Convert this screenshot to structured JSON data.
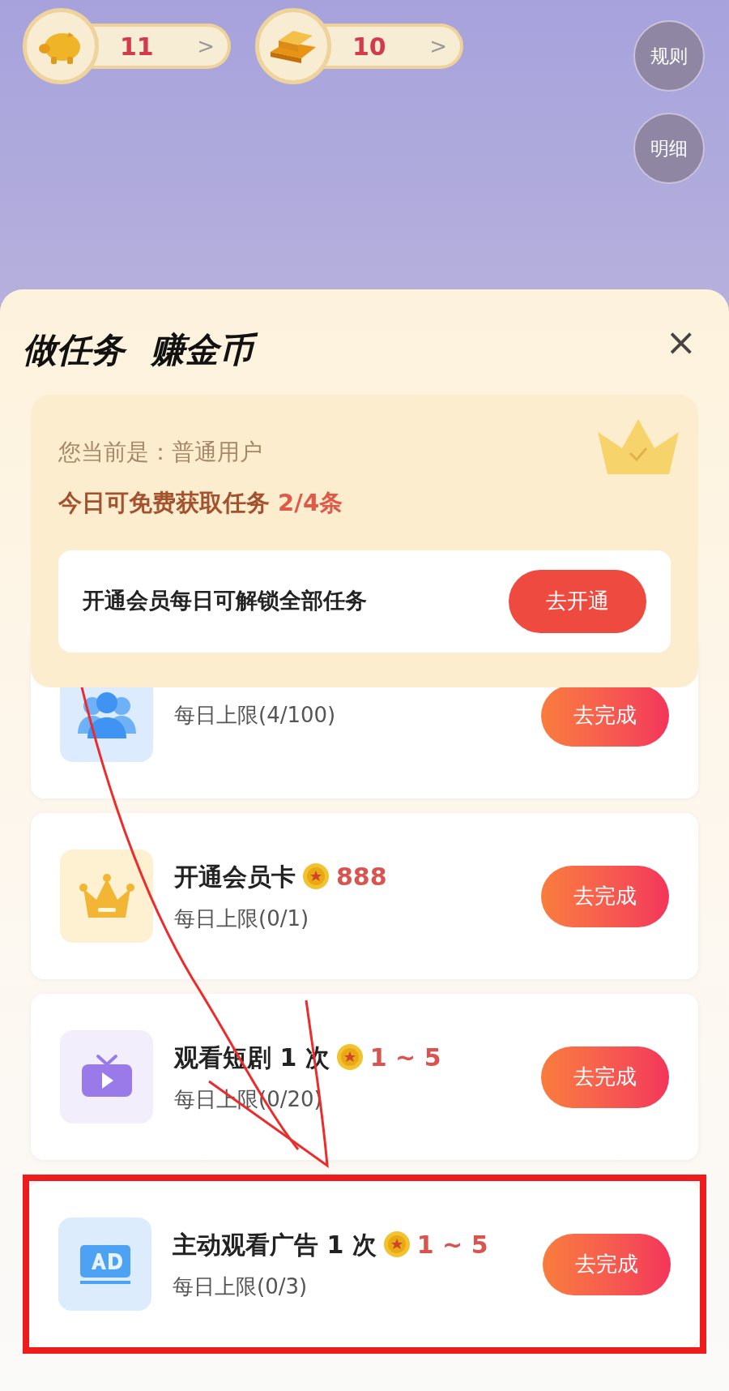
{
  "balances": [
    {
      "kind": "piggy",
      "value": "11",
      "arrow": ">"
    },
    {
      "kind": "gold",
      "value": "10",
      "arrow": ">"
    }
  ],
  "side_buttons": [
    "规则",
    "明细"
  ],
  "sheet": {
    "title_parts": [
      "做任务",
      "赚金币"
    ],
    "close": "×",
    "member": {
      "status": "您当前是：普通用户",
      "quota": "今日可免费获取任务 **2/4条**",
      "promo": "开通会员每日可解锁全部任务",
      "button": "去开通"
    },
    "tasks": [
      {
        "kind": "people",
        "limit": "每日上限(4/100)",
        "button": "去完成",
        "highlighted": false
      },
      {
        "kind": "crown",
        "title": "开通会员卡",
        "reward": "888",
        "limit": "每日上限(0/1)",
        "button": "去完成",
        "highlighted": false
      },
      {
        "kind": "tv",
        "title": "观看短剧 1 次",
        "reward": "1 ~ 5",
        "limit": "每日上限(0/20)",
        "button": "去完成",
        "highlighted": false
      },
      {
        "kind": "ad",
        "title": "主动观看广告 1 次",
        "reward": "1 ~ 5",
        "limit": "每日上限(0/3)",
        "button": "去完成",
        "highlighted": true
      }
    ]
  }
}
